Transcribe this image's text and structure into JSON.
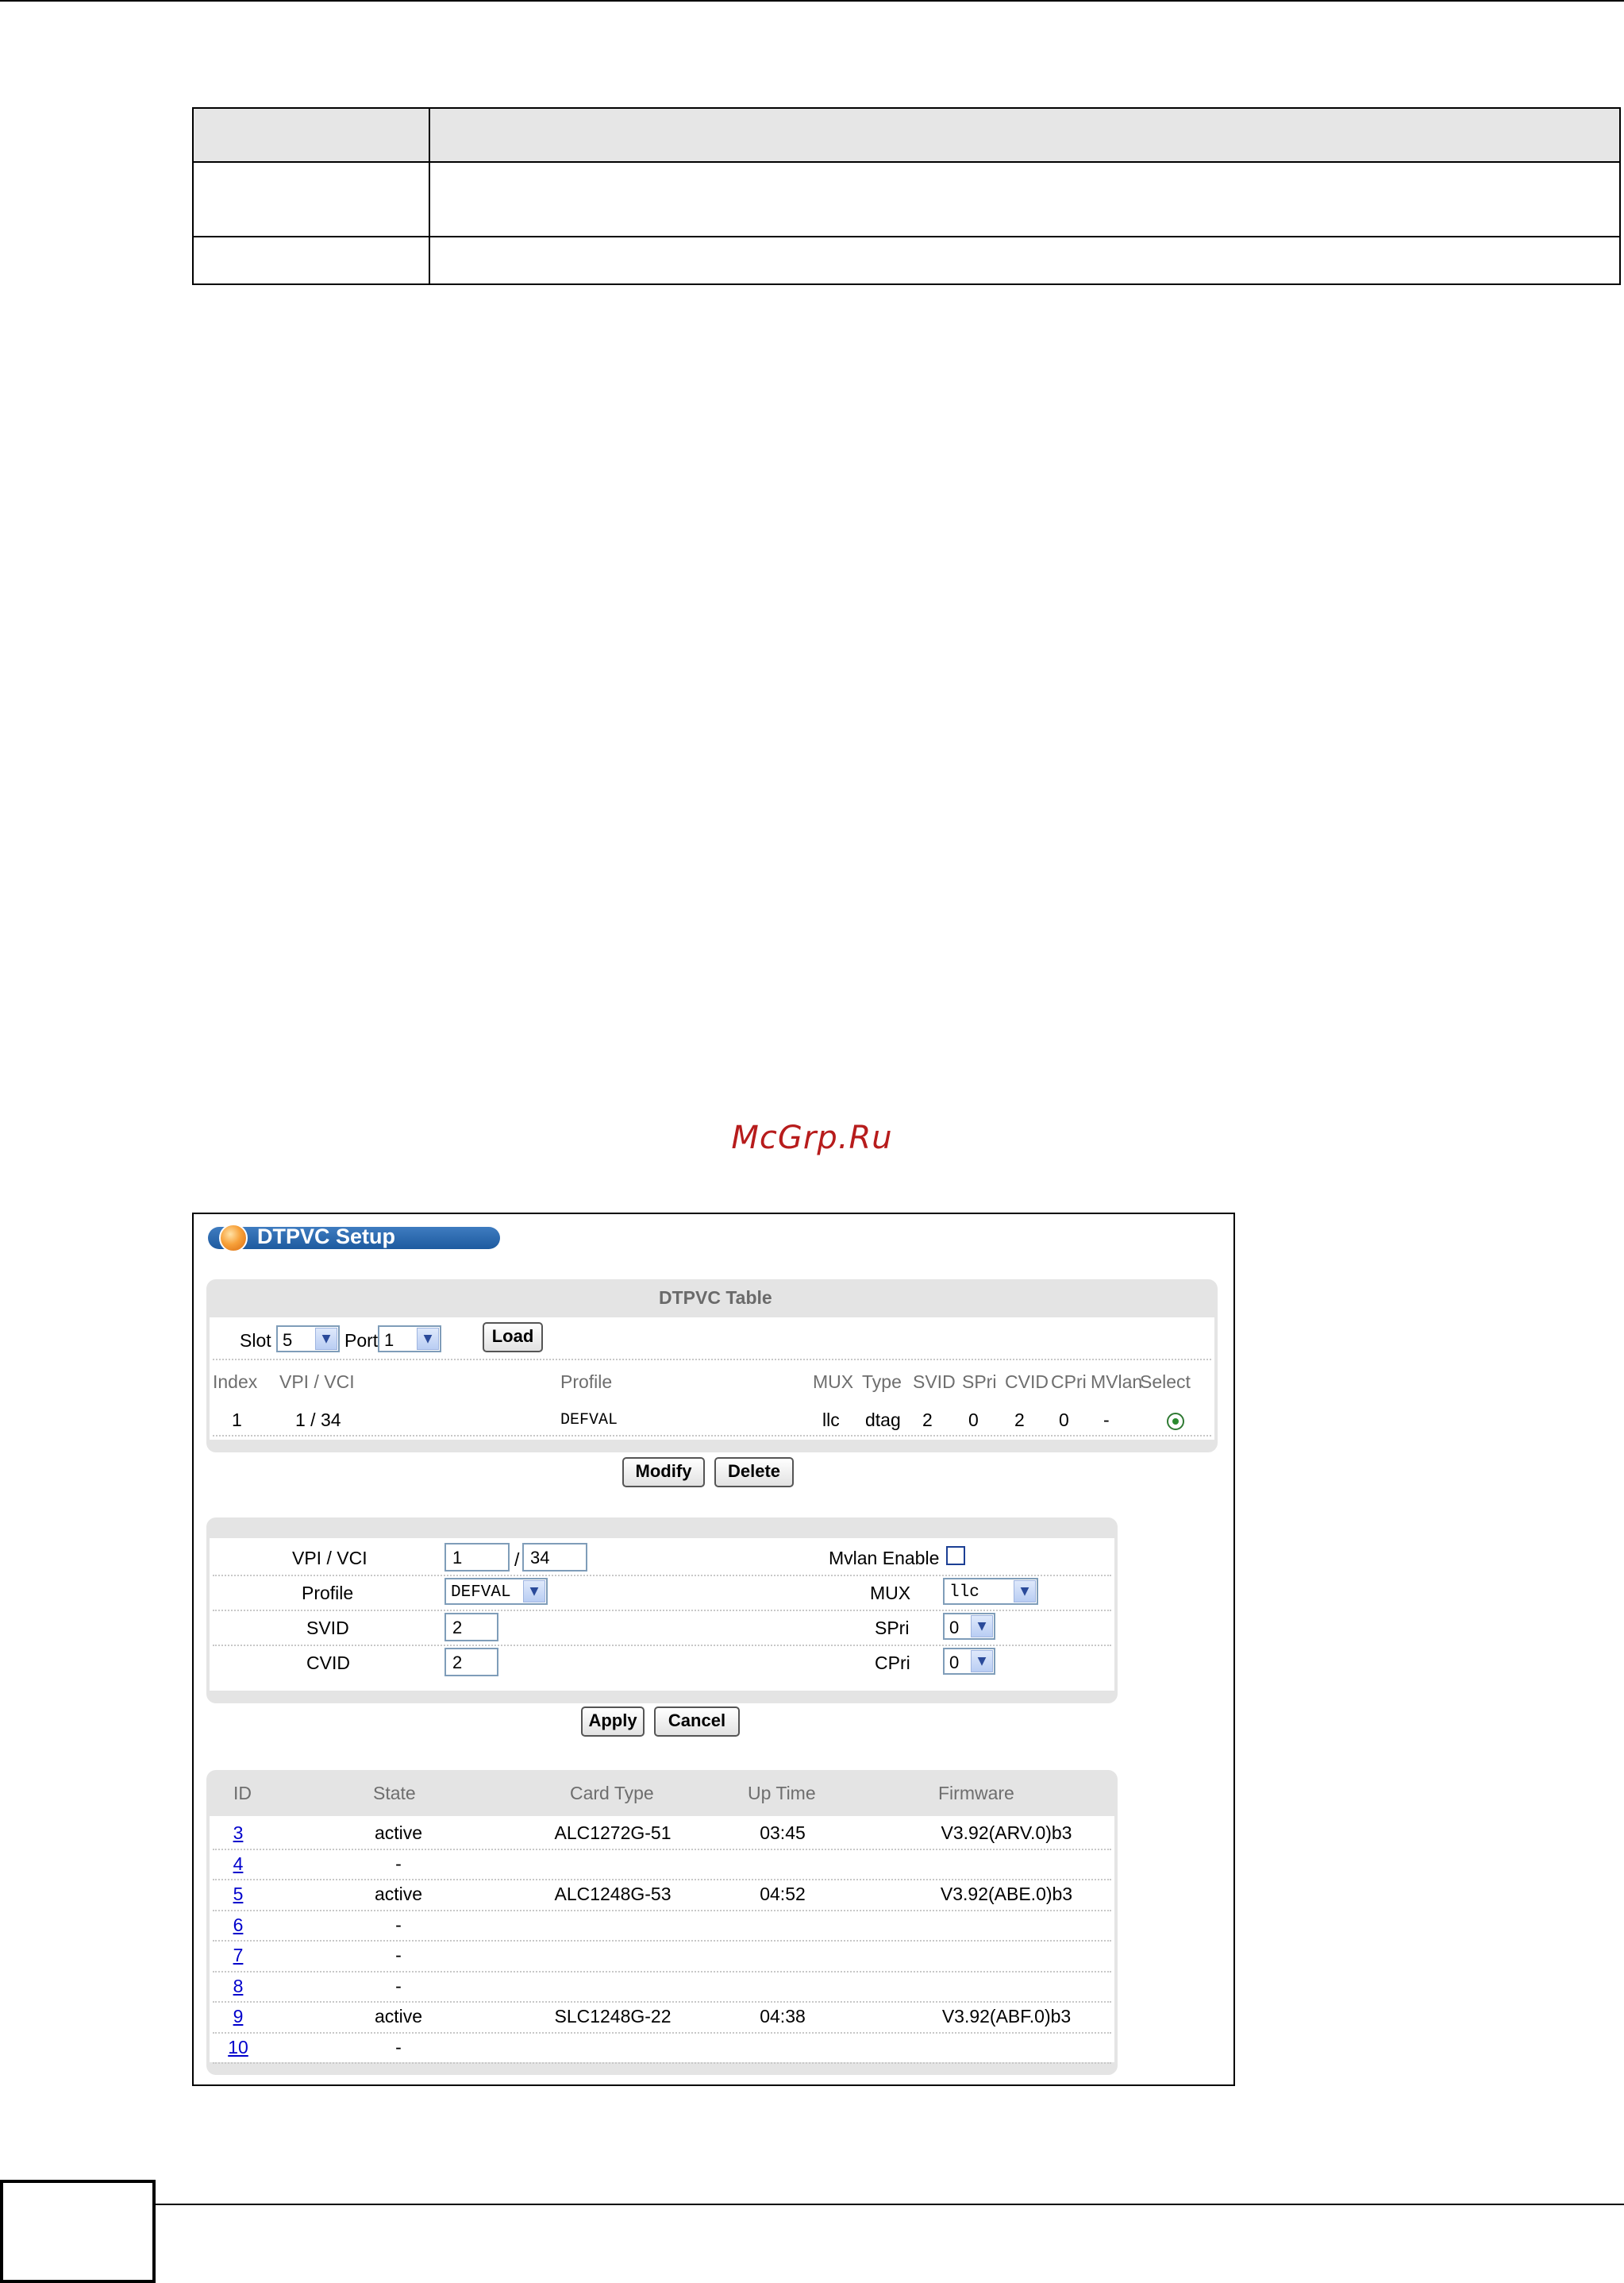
{
  "watermark": "McGrp.Ru",
  "setup": {
    "title": "DTPVC Setup",
    "table_title": "DTPVC Table",
    "slot_label": "Slot",
    "slot_value": "5",
    "port_label": "Port",
    "port_value": "1",
    "load_label": "Load",
    "columns": [
      "Index",
      "VPI / VCI",
      "Profile",
      "MUX",
      "Type",
      "SVID",
      "SPri",
      "CVID",
      "CPri",
      "MVlan",
      "Select"
    ],
    "row": {
      "index": "1",
      "vpi_vci": "1 / 34",
      "profile": "DEFVAL",
      "mux": "llc",
      "type": "dtag",
      "svid": "2",
      "spri": "0",
      "cvid": "2",
      "cpri": "0",
      "mvlan": "-"
    },
    "modify_label": "Modify",
    "delete_label": "Delete"
  },
  "form": {
    "vpi_vci_label": "VPI / VCI",
    "vpi_value": "1",
    "vci_value": "34",
    "slash": "/",
    "mvlan_label": "Mvlan Enable",
    "profile_label": "Profile",
    "profile_value": "DEFVAL",
    "mux_label": "MUX",
    "mux_value": "llc",
    "svid_label": "SVID",
    "svid_value": "2",
    "spri_label": "SPri",
    "spri_value": "0",
    "cvid_label": "CVID",
    "cvid_value": "2",
    "cpri_label": "CPri",
    "cpri_value": "0",
    "apply_label": "Apply",
    "cancel_label": "Cancel"
  },
  "cards": {
    "headers": {
      "id": "ID",
      "state": "State",
      "card_type": "Card Type",
      "up_time": "Up Time",
      "firmware": "Firmware"
    },
    "rows": [
      {
        "id": "3",
        "state": "active",
        "card_type": "ALC1272G-51",
        "up_time": "03:45",
        "firmware": "V3.92(ARV.0)b3"
      },
      {
        "id": "4",
        "state": "-",
        "card_type": "",
        "up_time": "",
        "firmware": ""
      },
      {
        "id": "5",
        "state": "active",
        "card_type": "ALC1248G-53",
        "up_time": "04:52",
        "firmware": "V3.92(ABE.0)b3"
      },
      {
        "id": "6",
        "state": "-",
        "card_type": "",
        "up_time": "",
        "firmware": ""
      },
      {
        "id": "7",
        "state": "-",
        "card_type": "",
        "up_time": "",
        "firmware": ""
      },
      {
        "id": "8",
        "state": "-",
        "card_type": "",
        "up_time": "",
        "firmware": ""
      },
      {
        "id": "9",
        "state": "active",
        "card_type": "SLC1248G-22",
        "up_time": "04:38",
        "firmware": "V3.92(ABF.0)b3"
      },
      {
        "id": "10",
        "state": "-",
        "card_type": "",
        "up_time": "",
        "firmware": ""
      }
    ]
  }
}
